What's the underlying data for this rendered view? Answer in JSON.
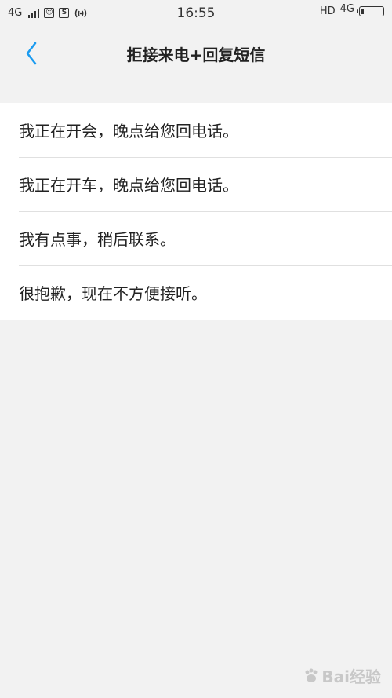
{
  "status_bar": {
    "network_left": "4G",
    "time": "16:55",
    "hd_label": "HD",
    "network_right": "4G",
    "battery_level": 0.12
  },
  "header": {
    "title": "拒接来电+回复短信"
  },
  "replies": [
    {
      "text": "我正在开会，晚点给您回电话。"
    },
    {
      "text": "我正在开车，晚点给您回电话。"
    },
    {
      "text": "我有点事，稍后联系。"
    },
    {
      "text": "很抱歉，现在不方便接听。"
    }
  ],
  "watermark": {
    "text": "Bai经验"
  },
  "colors": {
    "accent": "#1a9bf0",
    "background": "#f2f2f2",
    "list_background": "#ffffff"
  }
}
